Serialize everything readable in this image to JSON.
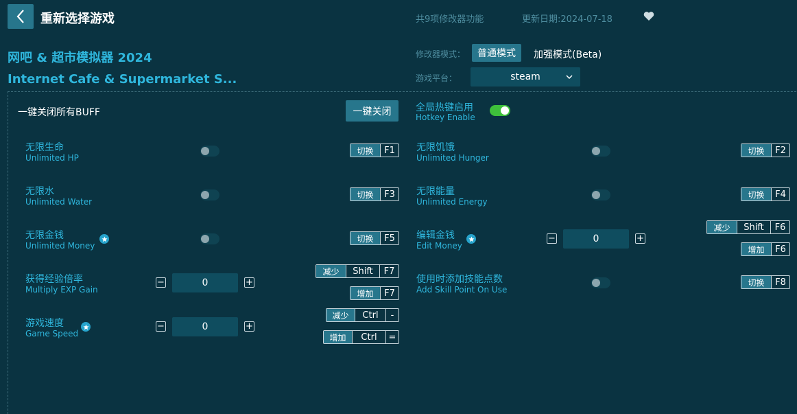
{
  "header": {
    "title": "重新选择游戏",
    "feature_count": "共9项修改器功能",
    "update_date": "更新日期:2024-07-18"
  },
  "game": {
    "name_cn": "网吧 & 超市模拟器 2024",
    "name_en": "Internet Cafe & Supermarket S..."
  },
  "mode": {
    "label": "修改器模式：",
    "normal": "普通模式",
    "enhanced": "加强模式(Beta)"
  },
  "platform": {
    "label": "游戏平台：",
    "value": "steam"
  },
  "buff": {
    "label": "一键关闭所有BUFF",
    "button": "一键关闭"
  },
  "hotkey": {
    "cn": "全局热键启用",
    "en": "Hotkey Enable"
  },
  "features": {
    "hp": {
      "cn": "无限生命",
      "en": "Unlimited HP",
      "tag": "切换",
      "key": "F1"
    },
    "hunger": {
      "cn": "无限饥饿",
      "en": "Unlimited Hunger",
      "tag": "切换",
      "key": "F2"
    },
    "water": {
      "cn": "无限水",
      "en": "Unlimited Water",
      "tag": "切换",
      "key": "F3"
    },
    "energy": {
      "cn": "无限能量",
      "en": "Unlimited Energy",
      "tag": "切换",
      "key": "F4"
    },
    "money": {
      "cn": "无限金钱",
      "en": "Unlimited Money",
      "tag": "切换",
      "key": "F5"
    },
    "edit_money": {
      "cn": "编辑金钱",
      "en": "Edit Money",
      "value": "0",
      "dec_tag": "减少",
      "dec_mod": "Shift",
      "dec_key": "F6",
      "inc_tag": "增加",
      "inc_key": "F6"
    },
    "exp": {
      "cn": "获得经验倍率",
      "en": "Multiply EXP Gain",
      "value": "0",
      "dec_tag": "减少",
      "dec_mod": "Shift",
      "dec_key": "F7",
      "inc_tag": "增加",
      "inc_key": "F7"
    },
    "skill": {
      "cn": "使用时添加技能点数",
      "en": "Add Skill Point On Use",
      "tag": "切换",
      "key": "F8"
    },
    "speed": {
      "cn": "游戏速度",
      "en": "Game Speed",
      "value": "0",
      "dec_tag": "减少",
      "dec_mod": "Ctrl",
      "dec_key": "-",
      "inc_tag": "增加",
      "inc_mod": "Ctrl",
      "inc_key": "="
    }
  },
  "stepper": {
    "minus": "−",
    "plus": "+"
  },
  "colors": {
    "accent": "#2fb6dc",
    "button": "#27768c",
    "background": "#0a3341",
    "toggle_on": "#3ec03b"
  }
}
